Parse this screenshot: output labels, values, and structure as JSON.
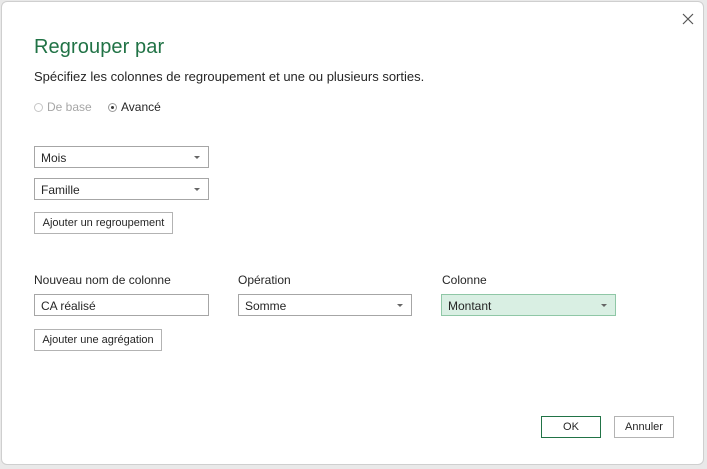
{
  "dialog": {
    "title": "Regrouper par",
    "subtitle": "Spécifiez les colonnes de regroupement et une ou plusieurs sorties.",
    "close_icon": "close-icon"
  },
  "mode": {
    "basic_label": "De base",
    "advanced_label": "Avancé",
    "selected": "Avancé"
  },
  "grouping": {
    "fields": [
      "Mois",
      "Famille"
    ],
    "add_button": "Ajouter un regroupement"
  },
  "aggregation": {
    "headers": {
      "new_column": "Nouveau nom de colonne",
      "operation": "Opération",
      "column": "Colonne"
    },
    "row": {
      "new_column_value": "CA réalisé",
      "operation_value": "Somme",
      "column_value": "Montant"
    },
    "add_button": "Ajouter une agrégation"
  },
  "footer": {
    "ok_label": "OK",
    "cancel_label": "Annuler"
  },
  "colors": {
    "accent": "#217346",
    "active_select": "#d9efe3"
  }
}
